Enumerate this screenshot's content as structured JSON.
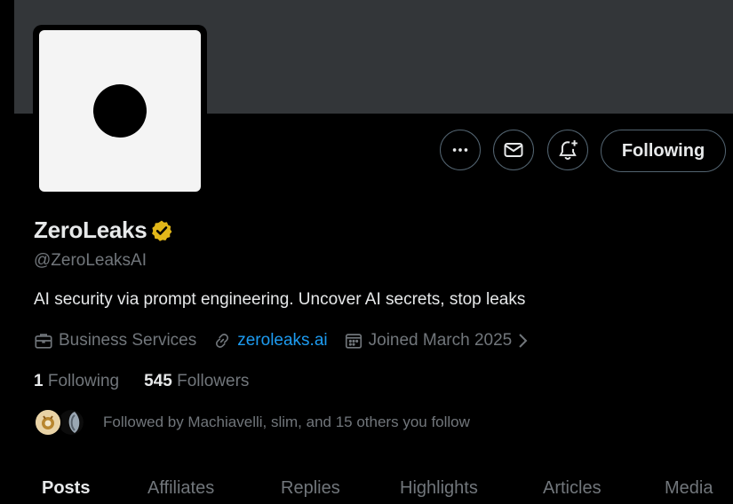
{
  "profile": {
    "display_name": "ZeroLeaks",
    "handle": "@ZeroLeaksAI",
    "bio": "AI security via prompt engineering. Uncover AI secrets, stop leaks",
    "category": "Business Services",
    "website": "zeroleaks.ai",
    "joined": "Joined March 2025"
  },
  "actions": {
    "follow_label": "Following",
    "more_icon": "ellipsis-icon",
    "message_icon": "mail-icon",
    "notify_icon": "bell-plus-icon"
  },
  "stats": {
    "following_count": "1",
    "following_label": "Following",
    "followers_count": "545",
    "followers_label": "Followers"
  },
  "followed_by": {
    "text": "Followed by Machiavelli, slim, and 15 others you follow"
  },
  "tabs": [
    {
      "label": "Posts",
      "active": true
    },
    {
      "label": "Affiliates",
      "active": false
    },
    {
      "label": "Replies",
      "active": false
    },
    {
      "label": "Highlights",
      "active": false
    },
    {
      "label": "Articles",
      "active": false
    },
    {
      "label": "Media",
      "active": false
    }
  ],
  "colors": {
    "background": "#000000",
    "banner": "#333639",
    "text_primary": "#e7e9ea",
    "text_secondary": "#71767b",
    "link": "#1d9bf0",
    "verified_gold": "#e2b719",
    "border": "#536471"
  }
}
